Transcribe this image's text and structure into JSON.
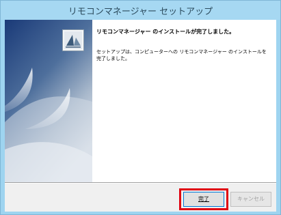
{
  "window": {
    "title": "リモコンマネージャー セットアップ"
  },
  "main": {
    "heading": "リモコンマネージャー のインストールが完了しました。",
    "body": "セットアップは、コンピューターへの リモコンマネージャー のインストールを完了しました。"
  },
  "buttons": {
    "finish_label": "完了",
    "cancel_label": "キャンセル"
  },
  "colors": {
    "title_bar": "#a6d8f2",
    "banner_top": "#1a3a78",
    "banner_bottom": "#dfe6ee",
    "highlight": "#e00010"
  },
  "icons": {
    "logo": "installer-logo-icon"
  }
}
